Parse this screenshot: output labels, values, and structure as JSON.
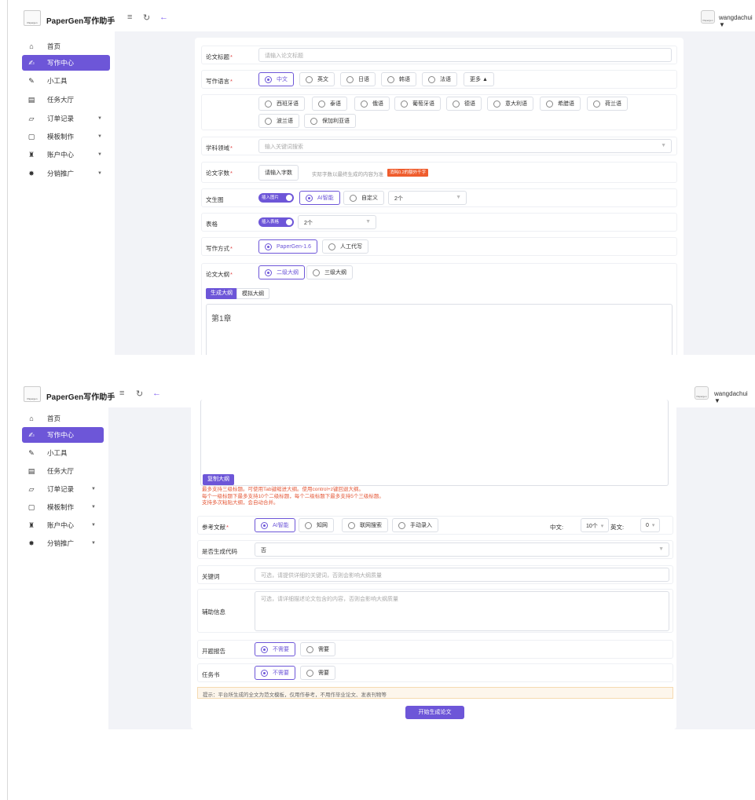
{
  "app": {
    "title": "PaperGen写作助手",
    "logo_text": "Papergen"
  },
  "topbar": {
    "username": "wangdachui",
    "user_caret": "▼",
    "avatar_text": "Papergen",
    "menu_glyph": "≡",
    "refresh_glyph": "↻",
    "back_glyph": "←"
  },
  "sidebar": {
    "items": [
      {
        "label": "首页",
        "icon": "home-icon",
        "glyph": "⌂",
        "arrow": ""
      },
      {
        "label": "写作中心",
        "icon": "writing-icon",
        "glyph": "✍",
        "arrow": ""
      },
      {
        "label": "小工具",
        "icon": "tools-icon",
        "glyph": "✎",
        "arrow": ""
      },
      {
        "label": "任务大厅",
        "icon": "task-icon",
        "glyph": "▤",
        "arrow": ""
      },
      {
        "label": "订单记录",
        "icon": "order-icon",
        "glyph": "▱",
        "arrow": "▼"
      },
      {
        "label": "模板制作",
        "icon": "template-icon",
        "glyph": "▢",
        "arrow": "▼"
      },
      {
        "label": "账户中心",
        "icon": "account-icon",
        "glyph": "♜",
        "arrow": "▼"
      },
      {
        "label": "分销推广",
        "icon": "promote-icon",
        "glyph": "✸",
        "arrow": "▼"
      }
    ],
    "active_index": 1
  },
  "form": {
    "title": {
      "label": "论文标题",
      "req": "*",
      "placeholder": "请输入论文标题"
    },
    "language": {
      "label": "写作语言",
      "req": "*",
      "options": [
        "中文",
        "英文",
        "日语",
        "韩语",
        "法语"
      ],
      "selected": "中文",
      "more_label": "更多 ▲",
      "more_options": [
        "西班牙语",
        "泰语",
        "俄语",
        "葡萄牙语",
        "德语",
        "意大利语",
        "希腊语",
        "荷兰语",
        "波兰语",
        "保加利亚语"
      ]
    },
    "subject": {
      "label": "学科领域",
      "req": "*",
      "placeholder": "输入关键词搜索"
    },
    "word_count": {
      "label": "论文字数",
      "req": "*",
      "button": "请输入字数",
      "hint": "实际字数以最终生成的内容为准",
      "tag": "消耗0.2的额外千字"
    },
    "image": {
      "label": "文生图",
      "switch_label": "插入图片",
      "options": [
        "AI智能",
        "自定义"
      ],
      "selected": "AI智能",
      "count": "2个"
    },
    "table": {
      "label": "表格",
      "switch_label": "插入表格",
      "count": "2个"
    },
    "mode": {
      "label": "写作方式",
      "req": "*",
      "options": [
        "PaperGen-1.6",
        "人工代写"
      ],
      "selected": "PaperGen-1.6"
    },
    "outline": {
      "label": "论文大纲",
      "req": "*",
      "options": [
        "二级大纲",
        "三级大纲"
      ],
      "selected": "二级大纲",
      "tabs": [
        "生成大纲",
        "模拟大纲"
      ],
      "editor_text": "第1章",
      "copy_button": "复制大纲",
      "notes": [
        "最多支持三级标题。可使用Tab键缩进大纲。使用control+z键回退大纲。",
        "每个一级标题下最多支持10个二级标题，每个二级标题下最多支持5个三级标题。",
        "支持多次粘贴大纲，会自动合并。"
      ]
    },
    "references": {
      "label": "参考文献",
      "req": "*",
      "options": [
        "AI智能",
        "知网",
        "联网搜索",
        "手动录入"
      ],
      "selected": "AI智能",
      "cn_label": "中文:",
      "cn_value": "10个",
      "en_label": "英文:",
      "en_value": "0"
    },
    "code": {
      "label": "是否生成代码",
      "value": "否"
    },
    "keywords": {
      "label": "关键词",
      "placeholder": "可选，请提供详细的关键词，否则会影响大纲质量"
    },
    "extra": {
      "label": "辅助信息",
      "placeholder": "可选，请详细描述论文包含的内容，否则会影响大纲质量"
    },
    "proposal": {
      "label": "开题报告",
      "options": [
        "不需要",
        "需要"
      ],
      "selected": "不需要"
    },
    "assignment": {
      "label": "任务书",
      "options": [
        "不需要",
        "需要"
      ],
      "selected": "不需要"
    },
    "notice": "提示：平台所生成的全文为范文模板，仅用作参考，不用作毕业论文、发表刊物等",
    "submit": "开始生成论文"
  }
}
